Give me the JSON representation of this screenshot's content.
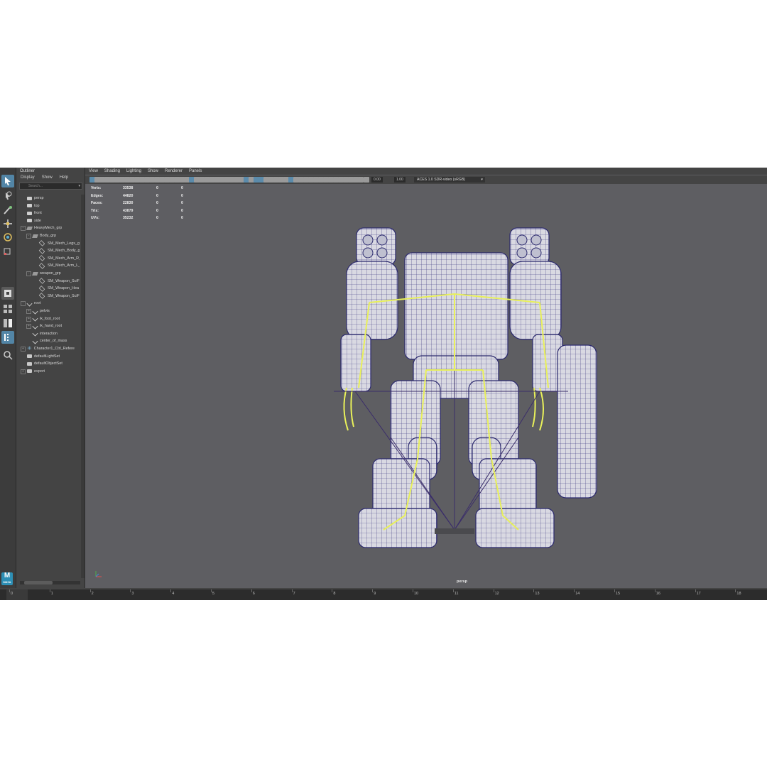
{
  "outliner": {
    "title": "Outliner",
    "menu": [
      "Display",
      "Show",
      "Help"
    ],
    "search_placeholder": "Search...",
    "items": [
      {
        "label": "persp",
        "icon": "camera-icon",
        "depth": 1
      },
      {
        "label": "top",
        "icon": "camera-icon",
        "depth": 1
      },
      {
        "label": "front",
        "icon": "camera-icon",
        "depth": 1
      },
      {
        "label": "side",
        "icon": "camera-icon",
        "depth": 1
      },
      {
        "label": "HeavyMech_grp",
        "icon": "group-icon",
        "depth": 1,
        "expand": "-"
      },
      {
        "label": "Body_grp",
        "icon": "group-icon",
        "depth": 2,
        "expand": "-"
      },
      {
        "label": "SM_Mech_Legs_g",
        "icon": "mesh-icon",
        "depth": 3
      },
      {
        "label": "SM_Mech_Body_g",
        "icon": "mesh-icon",
        "depth": 3
      },
      {
        "label": "SM_Mech_Arm_R_",
        "icon": "mesh-icon",
        "depth": 3
      },
      {
        "label": "SM_Mech_Arm_L_",
        "icon": "mesh-icon",
        "depth": 3
      },
      {
        "label": "weapon_grp",
        "icon": "group-icon",
        "depth": 2,
        "expand": "-"
      },
      {
        "label": "SM_Weapon_SciFi",
        "icon": "mesh-icon",
        "depth": 3
      },
      {
        "label": "SM_Weapon_Hea",
        "icon": "mesh-icon",
        "depth": 3
      },
      {
        "label": "SM_Weapon_SciFi",
        "icon": "mesh-icon",
        "depth": 3
      },
      {
        "label": "root",
        "icon": "joint-icon",
        "depth": 1,
        "expand": "-"
      },
      {
        "label": "pelvis",
        "icon": "joint-icon",
        "depth": 2,
        "expand": "+"
      },
      {
        "label": "ik_foot_root",
        "icon": "joint-icon",
        "depth": 2,
        "expand": "+"
      },
      {
        "label": "ik_hand_root",
        "icon": "joint-icon",
        "depth": 2,
        "expand": "+"
      },
      {
        "label": "interaction",
        "icon": "joint-icon",
        "depth": 2
      },
      {
        "label": "center_of_mass",
        "icon": "joint-icon",
        "depth": 2
      },
      {
        "label": "Character1_Ctrl_Refere",
        "icon": "control-icon",
        "depth": 1,
        "expand": "+"
      },
      {
        "label": "defaultLightSet",
        "icon": "set-icon",
        "depth": 1
      },
      {
        "label": "defaultObjectSet",
        "icon": "set-icon",
        "depth": 1
      },
      {
        "label": "export",
        "icon": "set-icon",
        "depth": 1,
        "expand": "+"
      }
    ]
  },
  "viewport": {
    "menu": [
      "View",
      "Shading",
      "Lighting",
      "Show",
      "Renderer",
      "Panels"
    ],
    "exposure": "0.00",
    "gamma": "1.00",
    "color_space": "ACES 1.0 SDR-video (sRGB)",
    "camera_label": "persp",
    "hud": [
      {
        "label": "Verts:",
        "v1": "33538",
        "v2": "0",
        "v3": "0"
      },
      {
        "label": "Edges:",
        "v1": "44820",
        "v2": "0",
        "v3": "0"
      },
      {
        "label": "Faces:",
        "v1": "22830",
        "v2": "0",
        "v3": "0"
      },
      {
        "label": "Tris:",
        "v1": "43879",
        "v2": "0",
        "v3": "0"
      },
      {
        "label": "UVs:",
        "v1": "35232",
        "v2": "0",
        "v3": "0"
      }
    ]
  },
  "timeline": {
    "frames": [
      "0",
      "1",
      "2",
      "3",
      "4",
      "5",
      "6",
      "7",
      "8",
      "9",
      "10",
      "11",
      "12",
      "13",
      "14",
      "15",
      "16",
      "17",
      "18"
    ]
  },
  "colors": {
    "accent": "#5285a6",
    "viewport_bg": "#5e5e62",
    "skeleton": "#e8f05a",
    "wireframe": "#2c2a6e"
  }
}
